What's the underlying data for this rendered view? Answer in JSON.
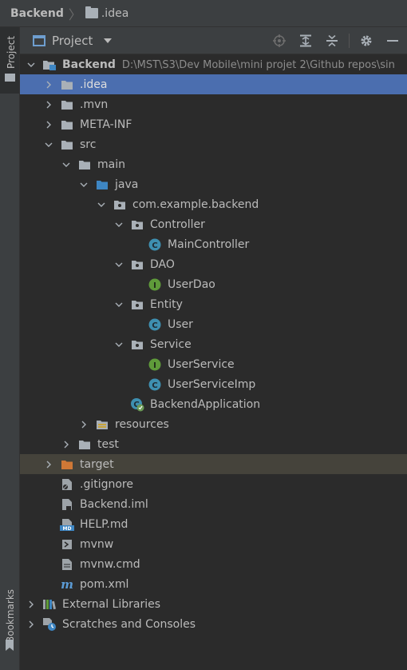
{
  "breadcrumb": {
    "root": "Backend",
    "item": ".idea"
  },
  "strip": {
    "project_tab": "Project",
    "bookmarks_tab": "Bookmarks"
  },
  "panel": {
    "title": "Project"
  },
  "tree": [
    {
      "label": "Backend",
      "path": "D:\\MST\\S3\\Dev Mobile\\mini projet 2\\Github repos\\sin",
      "depth": 0,
      "chevron": "down",
      "icon": "module-folder",
      "bold": true
    },
    {
      "label": ".idea",
      "depth": 1,
      "chevron": "right",
      "icon": "folder",
      "state": "selected"
    },
    {
      "label": ".mvn",
      "depth": 1,
      "chevron": "right",
      "icon": "folder"
    },
    {
      "label": "META-INF",
      "depth": 1,
      "chevron": "right",
      "icon": "folder"
    },
    {
      "label": "src",
      "depth": 1,
      "chevron": "down",
      "icon": "folder"
    },
    {
      "label": "main",
      "depth": 2,
      "chevron": "down",
      "icon": "folder"
    },
    {
      "label": "java",
      "depth": 3,
      "chevron": "down",
      "icon": "source-folder"
    },
    {
      "label": "com.example.backend",
      "depth": 4,
      "chevron": "down",
      "icon": "package"
    },
    {
      "label": "Controller",
      "depth": 5,
      "chevron": "down",
      "icon": "package"
    },
    {
      "label": "MainController",
      "depth": 6,
      "chevron": "none",
      "icon": "class"
    },
    {
      "label": "DAO",
      "depth": 5,
      "chevron": "down",
      "icon": "package"
    },
    {
      "label": "UserDao",
      "depth": 6,
      "chevron": "none",
      "icon": "interface"
    },
    {
      "label": "Entity",
      "depth": 5,
      "chevron": "down",
      "icon": "package"
    },
    {
      "label": "User",
      "depth": 6,
      "chevron": "none",
      "icon": "class"
    },
    {
      "label": "Service",
      "depth": 5,
      "chevron": "down",
      "icon": "package"
    },
    {
      "label": "UserService",
      "depth": 6,
      "chevron": "none",
      "icon": "interface"
    },
    {
      "label": "UserServiceImp",
      "depth": 6,
      "chevron": "none",
      "icon": "class"
    },
    {
      "label": "BackendApplication",
      "depth": 5,
      "chevron": "none",
      "icon": "spring-app"
    },
    {
      "label": "resources",
      "depth": 3,
      "chevron": "right",
      "icon": "resources-folder"
    },
    {
      "label": "test",
      "depth": 2,
      "chevron": "right",
      "icon": "folder"
    },
    {
      "label": "target",
      "depth": 1,
      "chevron": "right",
      "icon": "excluded-folder",
      "state": "highlight"
    },
    {
      "label": ".gitignore",
      "depth": 1,
      "chevron": "none",
      "icon": "gitignore-file"
    },
    {
      "label": "Backend.iml",
      "depth": 1,
      "chevron": "none",
      "icon": "iml-file"
    },
    {
      "label": "HELP.md",
      "depth": 1,
      "chevron": "none",
      "icon": "markdown-file"
    },
    {
      "label": "mvnw",
      "depth": 1,
      "chevron": "none",
      "icon": "shell-file"
    },
    {
      "label": "mvnw.cmd",
      "depth": 1,
      "chevron": "none",
      "icon": "text-file"
    },
    {
      "label": "pom.xml",
      "depth": 1,
      "chevron": "none",
      "icon": "maven-file"
    },
    {
      "label": "External Libraries",
      "depth": 0,
      "chevron": "right",
      "icon": "libraries"
    },
    {
      "label": "Scratches and Consoles",
      "depth": 0,
      "chevron": "right",
      "icon": "scratches"
    }
  ],
  "colors": {
    "selection": "#4b6eaf",
    "highlight": "#45433b",
    "folder": "#a9b0b7",
    "source_folder": "#3e86c3",
    "excluded_folder": "#cf7836",
    "class_icon": "#3e8fb0",
    "interface_icon": "#5f9b3a"
  }
}
